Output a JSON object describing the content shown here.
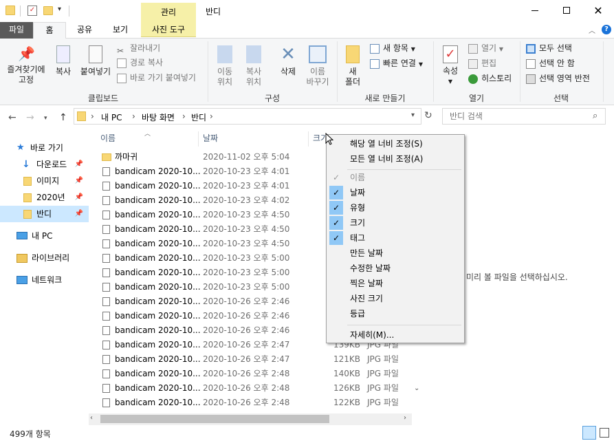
{
  "window": {
    "title": "반디",
    "context_tab": "관리",
    "context_subtab": "사진 도구"
  },
  "tabs": [
    "파일",
    "홈",
    "공유",
    "보기"
  ],
  "ribbon": {
    "clipboard": {
      "label": "클립보드",
      "pin_label": "즐겨찾기에\n고정",
      "copy_label": "복사",
      "paste_label": "붙여넣기",
      "cut_label": "잘라내기",
      "copy_path_label": "경로 복사",
      "paste_shortcut_label": "바로 가기 붙여넣기"
    },
    "organize": {
      "label": "구성",
      "move_to_label": "이동\n위치",
      "copy_to_label": "복사\n위치",
      "delete_label": "삭제",
      "rename_label": "이름\n바꾸기"
    },
    "new": {
      "label": "새로 만들기",
      "new_folder_label": "새\n폴더",
      "new_item_label": "새 항목",
      "easy_access_label": "빠른 연결"
    },
    "open": {
      "label": "열기",
      "properties_label": "속성",
      "open_label": "열기",
      "edit_label": "편집",
      "history_label": "히스토리"
    },
    "select": {
      "label": "선택",
      "select_all_label": "모두 선택",
      "select_none_label": "선택 안 함",
      "invert_label": "선택 영역 반전"
    }
  },
  "address": {
    "segments": [
      "내 PC",
      "바탕 화면",
      "반디"
    ],
    "search_placeholder": "반디 검색"
  },
  "nav": {
    "quick_access": "바로 가기",
    "items": [
      {
        "label": "다운로드",
        "pinned": true
      },
      {
        "label": "이미지",
        "pinned": true
      },
      {
        "label": "2020년",
        "pinned": true
      },
      {
        "label": "반디",
        "pinned": true
      }
    ],
    "this_pc": "내 PC",
    "libraries": "라이브러리",
    "network": "네트워크"
  },
  "columns": {
    "name": "이름",
    "date": "날짜",
    "size": "크기"
  },
  "files": [
    {
      "name": "까마귀",
      "date": "2020-11-02 오후 5:04",
      "size": "",
      "type": "",
      "folder": true
    },
    {
      "name": "bandicam 2020-10...",
      "date": "2020-10-23 오후 4:01",
      "size": "",
      "type": ""
    },
    {
      "name": "bandicam 2020-10...",
      "date": "2020-10-23 오후 4:01",
      "size": "",
      "type": ""
    },
    {
      "name": "bandicam 2020-10...",
      "date": "2020-10-23 오후 4:02",
      "size": "",
      "type": ""
    },
    {
      "name": "bandicam 2020-10...",
      "date": "2020-10-23 오후 4:50",
      "size": "",
      "type": ""
    },
    {
      "name": "bandicam 2020-10...",
      "date": "2020-10-23 오후 4:50",
      "size": "",
      "type": ""
    },
    {
      "name": "bandicam 2020-10...",
      "date": "2020-10-23 오후 4:50",
      "size": "",
      "type": ""
    },
    {
      "name": "bandicam 2020-10...",
      "date": "2020-10-23 오후 5:00",
      "size": "",
      "type": ""
    },
    {
      "name": "bandicam 2020-10...",
      "date": "2020-10-23 오후 5:00",
      "size": "",
      "type": ""
    },
    {
      "name": "bandicam 2020-10...",
      "date": "2020-10-23 오후 5:00",
      "size": "",
      "type": ""
    },
    {
      "name": "bandicam 2020-10...",
      "date": "2020-10-26 오후 2:46",
      "size": "",
      "type": ""
    },
    {
      "name": "bandicam 2020-10...",
      "date": "2020-10-26 오후 2:46",
      "size": "",
      "type": ""
    },
    {
      "name": "bandicam 2020-10...",
      "date": "2020-10-26 오후 2:46",
      "size": "",
      "type": ""
    },
    {
      "name": "bandicam 2020-10...",
      "date": "2020-10-26 오후 2:47",
      "size": "139KB",
      "type": "JPG 파일"
    },
    {
      "name": "bandicam 2020-10...",
      "date": "2020-10-26 오후 2:47",
      "size": "121KB",
      "type": "JPG 파일"
    },
    {
      "name": "bandicam 2020-10...",
      "date": "2020-10-26 오후 2:48",
      "size": "140KB",
      "type": "JPG 파일"
    },
    {
      "name": "bandicam 2020-10...",
      "date": "2020-10-26 오후 2:48",
      "size": "126KB",
      "type": "JPG 파일"
    },
    {
      "name": "bandicam 2020-10...",
      "date": "2020-10-26 오후 2:48",
      "size": "122KB",
      "type": "JPG 파일"
    }
  ],
  "preview_message": "미리 볼 파일을 선택하십시오.",
  "status": {
    "item_count": "499개 항목"
  },
  "context_menu": {
    "size_column": "해당 열 너비 조정(S)",
    "size_all_columns": "모든 열 너비 조정(A)",
    "columns": [
      {
        "label": "이름",
        "checked": true,
        "disabled": true
      },
      {
        "label": "날짜",
        "checked": true
      },
      {
        "label": "유형",
        "checked": true
      },
      {
        "label": "크기",
        "checked": true
      },
      {
        "label": "태그",
        "checked": true
      },
      {
        "label": "만든 날짜",
        "checked": false
      },
      {
        "label": "수정한 날짜",
        "checked": false
      },
      {
        "label": "찍은 날짜",
        "checked": false
      },
      {
        "label": "사진 크기",
        "checked": false
      },
      {
        "label": "등급",
        "checked": false
      }
    ],
    "more": "자세히(M)..."
  },
  "colors": {
    "file_tab": "#5a5a5a",
    "context_tab": "#f6f0a8",
    "selection": "#cce8ff",
    "check_bg": "#90c8f6",
    "folder": "#f8d775",
    "header_text": "#4c607a"
  }
}
